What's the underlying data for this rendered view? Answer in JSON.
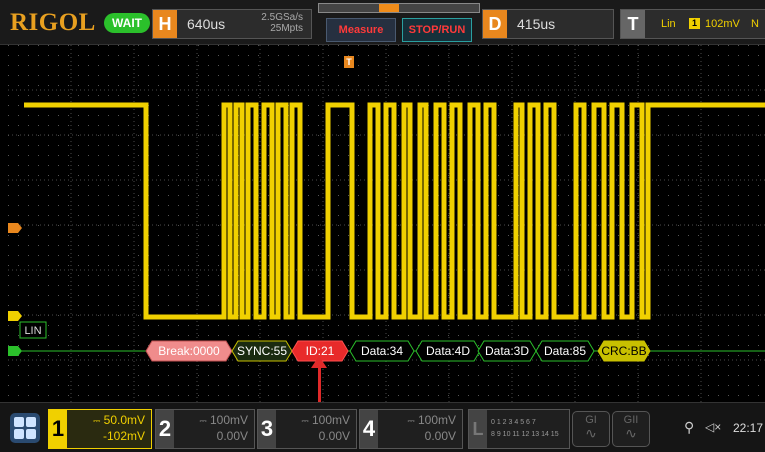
{
  "header": {
    "logo": "RIGOL",
    "run_state": "WAIT",
    "horizontal": {
      "letter": "H",
      "timebase": "640us",
      "sample_rate": "2.5GSa/s",
      "memory_depth": "25Mpts"
    },
    "measure_label": "Measure",
    "stop_run_label": "STOP/RUN",
    "delay": {
      "letter": "D",
      "value": "415us"
    },
    "trigger": {
      "letter": "T",
      "type": "Lin",
      "source": "1",
      "level": "102mV",
      "slope": "N"
    }
  },
  "screen": {
    "lin_label": "LIN",
    "decode_frames": [
      {
        "text": "Break:0000",
        "kind": "break"
      },
      {
        "text": "SYNC:55",
        "kind": "sync"
      },
      {
        "text": "ID:21",
        "kind": "id"
      },
      {
        "text": "Data:34",
        "kind": "data"
      },
      {
        "text": "Data:4D",
        "kind": "data"
      },
      {
        "text": "Data:3D",
        "kind": "data"
      },
      {
        "text": "Data:85",
        "kind": "data"
      },
      {
        "text": "CRC:BB",
        "kind": "crc"
      }
    ]
  },
  "channels": [
    {
      "number": "1",
      "scale": "50.0mV",
      "offset": "-102mV",
      "active": true
    },
    {
      "number": "2",
      "scale": "100mV",
      "offset": "0.00V",
      "active": false
    },
    {
      "number": "3",
      "scale": "100mV",
      "offset": "0.00V",
      "active": false
    },
    {
      "number": "4",
      "scale": "100mV",
      "offset": "0.00V",
      "active": false
    }
  ],
  "logic": {
    "letter": "L",
    "bits_row1": "0 1 2 3  4 5 6 7",
    "bits_row2": "8 9 10 11 12 13 14 15"
  },
  "generators": [
    {
      "label": "GI"
    },
    {
      "label": "GII"
    }
  ],
  "status": {
    "time": "22:17"
  },
  "colors": {
    "ch1": "#f0d000",
    "accent": "#e8871e",
    "decode_line": "#2bc02b",
    "break": "#f08c8c",
    "sync": "#c8c000",
    "id": "#e82a2a",
    "crc": "#c8c000"
  }
}
